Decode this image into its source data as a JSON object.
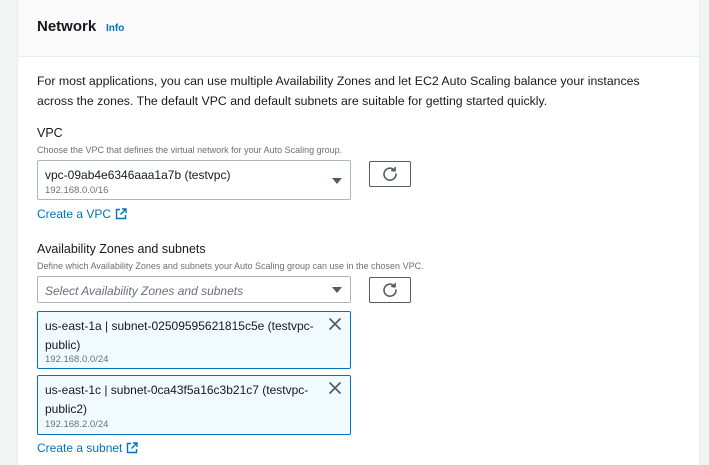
{
  "section": {
    "title": "Network",
    "info_label": "Info",
    "description": "For most applications, you can use multiple Availability Zones and let EC2 Auto Scaling balance your instances across the zones. The default VPC and default subnets are suitable for getting started quickly."
  },
  "vpc": {
    "label": "VPC",
    "description": "Choose the VPC that defines the virtual network for your Auto Scaling group.",
    "selected_value": "vpc-09ab4e6346aaa1a7b (testvpc)",
    "selected_cidr": "192.168.0.0/16",
    "create_link": "Create a VPC"
  },
  "subnets": {
    "label": "Availability Zones and subnets",
    "description": "Define which Availability Zones and subnets your Auto Scaling group can use in the chosen VPC.",
    "placeholder": "Select Availability Zones and subnets",
    "selected": [
      {
        "label": "us-east-1a | subnet-02509595621815c5e (testvpc-public)",
        "cidr": "192.168.0.0/24"
      },
      {
        "label": "us-east-1c | subnet-0ca43f5a16c3b21c7 (testvpc-public2)",
        "cidr": "192.168.2.0/24"
      }
    ],
    "create_link": "Create a subnet"
  },
  "icons": {
    "refresh": "refresh-icon",
    "dropdown": "caret-down-icon",
    "external": "external-link-icon",
    "remove": "close-icon"
  },
  "colors": {
    "link": "#0073bb",
    "token_bg": "#f1faff",
    "token_border": "#0073bb"
  }
}
